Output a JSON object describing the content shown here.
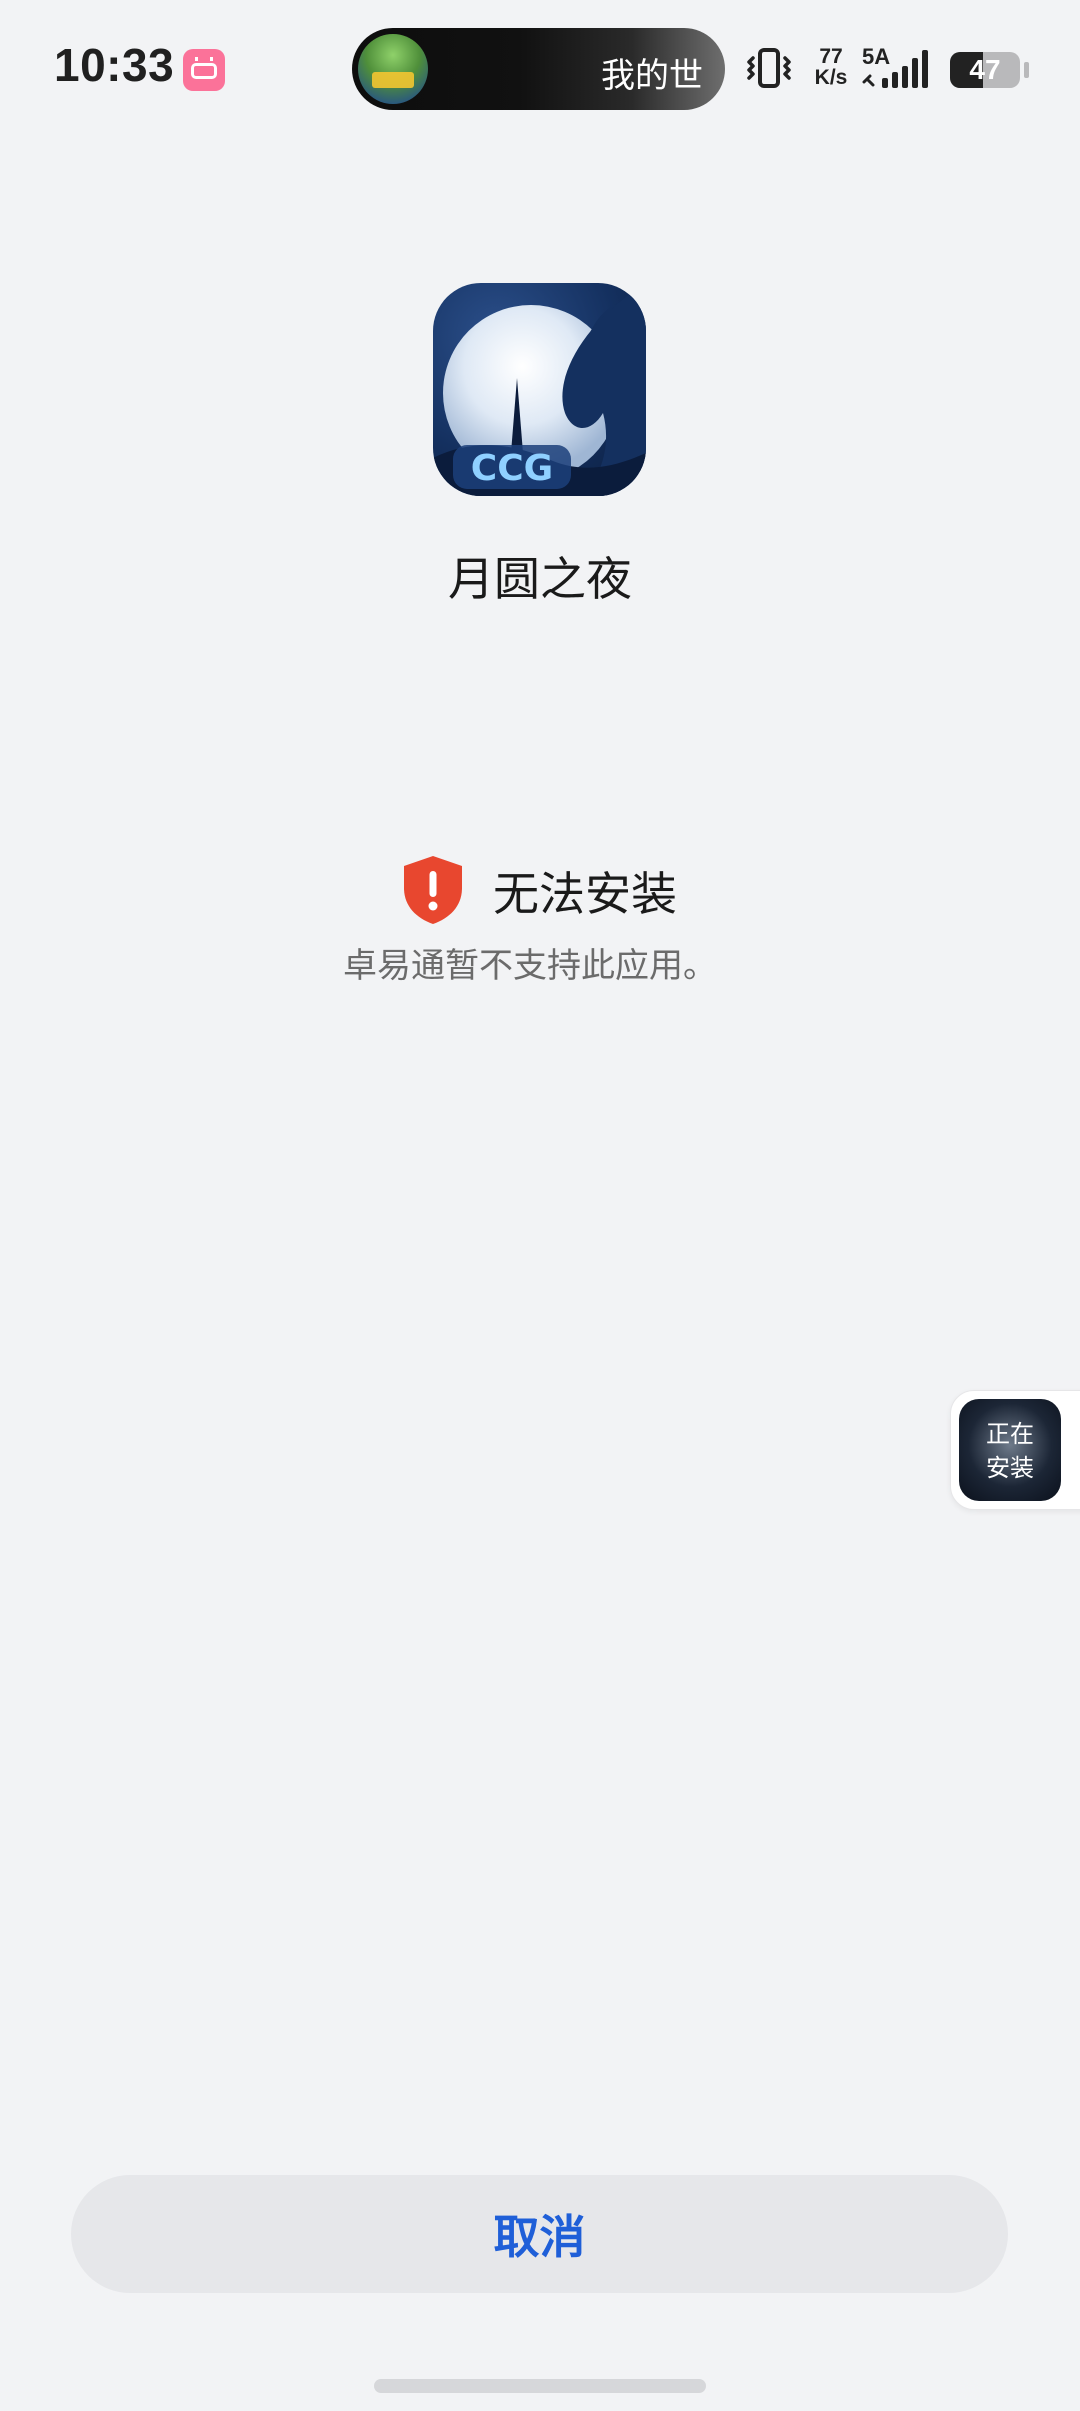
{
  "status_bar": {
    "time": "10:33",
    "notification_app_icon": "bilibili-icon",
    "media_pill_text": "我的世",
    "net_speed_value": "77",
    "net_speed_unit": "K/s",
    "signal_label": "5A",
    "battery_level": "47",
    "battery_fraction": 0.47
  },
  "app": {
    "name": "月圆之夜",
    "icon_badge_text": "CCG"
  },
  "error": {
    "title": "无法安装",
    "description": "卓易通暂不支持此应用。",
    "icon": "shield-alert-icon",
    "icon_color": "#e8472f"
  },
  "floating_widget": {
    "line1": "正在",
    "line2": "安装"
  },
  "actions": {
    "cancel_label": "取消",
    "cancel_color": "#1f5fd8"
  }
}
